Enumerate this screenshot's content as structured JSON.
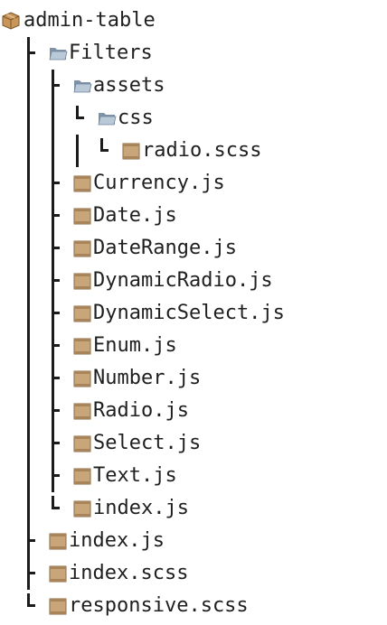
{
  "tree": {
    "root": {
      "name": "admin-table",
      "icon": "package-icon"
    },
    "nodes": [
      {
        "name": "Filters",
        "type": "folder",
        "icon": "folder-icon",
        "depth": 1,
        "last": false,
        "guides": []
      },
      {
        "name": "assets",
        "type": "folder",
        "icon": "folder-icon",
        "depth": 2,
        "last": false,
        "guides": [
          true
        ]
      },
      {
        "name": "css",
        "type": "folder",
        "icon": "folder-icon",
        "depth": 3,
        "last": true,
        "guides": [
          true,
          true
        ]
      },
      {
        "name": "radio.scss",
        "type": "file",
        "icon": "file-icon",
        "depth": 4,
        "last": true,
        "guides": [
          true,
          true,
          true
        ]
      },
      {
        "name": "Currency.js",
        "type": "file",
        "icon": "file-icon",
        "depth": 2,
        "last": false,
        "guides": [
          true
        ]
      },
      {
        "name": "Date.js",
        "type": "file",
        "icon": "file-icon",
        "depth": 2,
        "last": false,
        "guides": [
          true
        ]
      },
      {
        "name": "DateRange.js",
        "type": "file",
        "icon": "file-icon",
        "depth": 2,
        "last": false,
        "guides": [
          true
        ]
      },
      {
        "name": "DynamicRadio.js",
        "type": "file",
        "icon": "file-icon",
        "depth": 2,
        "last": false,
        "guides": [
          true
        ]
      },
      {
        "name": "DynamicSelect.js",
        "type": "file",
        "icon": "file-icon",
        "depth": 2,
        "last": false,
        "guides": [
          true
        ]
      },
      {
        "name": "Enum.js",
        "type": "file",
        "icon": "file-icon",
        "depth": 2,
        "last": false,
        "guides": [
          true
        ]
      },
      {
        "name": "Number.js",
        "type": "file",
        "icon": "file-icon",
        "depth": 2,
        "last": false,
        "guides": [
          true
        ]
      },
      {
        "name": "Radio.js",
        "type": "file",
        "icon": "file-icon",
        "depth": 2,
        "last": false,
        "guides": [
          true
        ]
      },
      {
        "name": "Select.js",
        "type": "file",
        "icon": "file-icon",
        "depth": 2,
        "last": false,
        "guides": [
          true
        ]
      },
      {
        "name": "Text.js",
        "type": "file",
        "icon": "file-icon",
        "depth": 2,
        "last": false,
        "guides": [
          true
        ]
      },
      {
        "name": "index.js",
        "type": "file",
        "icon": "file-icon",
        "depth": 2,
        "last": true,
        "guides": [
          true
        ]
      },
      {
        "name": "index.js",
        "type": "file",
        "icon": "file-icon",
        "depth": 1,
        "last": false,
        "guides": []
      },
      {
        "name": "index.scss",
        "type": "file",
        "icon": "file-icon",
        "depth": 1,
        "last": false,
        "guides": []
      },
      {
        "name": "responsive.scss",
        "type": "file",
        "icon": "file-icon",
        "depth": 1,
        "last": true,
        "guides": []
      }
    ]
  },
  "colors": {
    "line": "#1c1c1c",
    "text": "#1f1f1f",
    "folder_front": "#b9c9d8",
    "folder_back": "#7f93a8",
    "file_fill": "#c9a57a",
    "file_stroke": "#8a6a45",
    "package_fill": "#c8965a",
    "package_stroke": "#7d5528"
  }
}
